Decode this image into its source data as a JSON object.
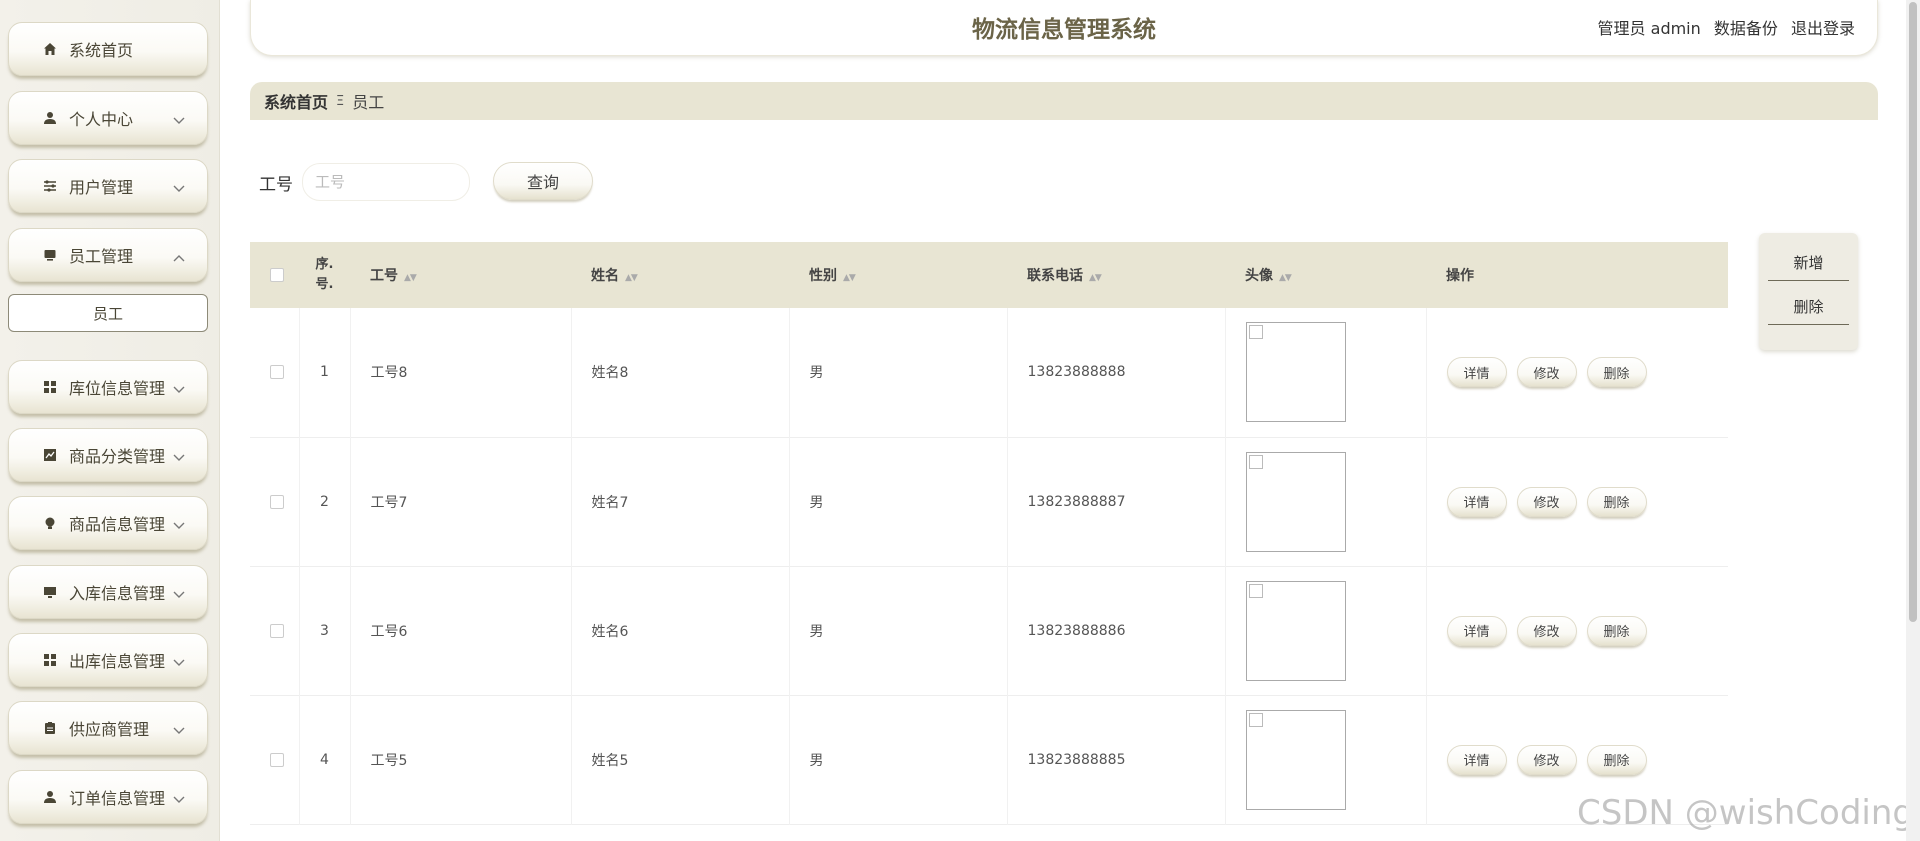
{
  "header": {
    "title": "物流信息管理系统",
    "user_label": "管理员 admin",
    "backup_link": "数据备份",
    "logout_link": "退出登录"
  },
  "sidebar": {
    "items": [
      {
        "label": "系统首页",
        "icon": "home-icon",
        "has_chevron": false
      },
      {
        "label": "个人中心",
        "icon": "person-icon",
        "has_chevron": true
      },
      {
        "label": "用户管理",
        "icon": "sliders-icon",
        "has_chevron": true
      },
      {
        "label": "员工管理",
        "icon": "monitor-icon",
        "has_chevron": true,
        "expanded": true
      },
      {
        "label": "库位信息管理",
        "icon": "grid-icon",
        "has_chevron": true
      },
      {
        "label": "商品分类管理",
        "icon": "chart-icon",
        "has_chevron": true
      },
      {
        "label": "商品信息管理",
        "icon": "bulb-icon",
        "has_chevron": true
      },
      {
        "label": "入库信息管理",
        "icon": "screen-icon",
        "has_chevron": true
      },
      {
        "label": "出库信息管理",
        "icon": "grid-icon",
        "has_chevron": true
      },
      {
        "label": "供应商管理",
        "icon": "clipboard-icon",
        "has_chevron": true
      },
      {
        "label": "订单信息管理",
        "icon": "person-icon",
        "has_chevron": true
      }
    ],
    "sub_item": "员工"
  },
  "breadcrumb": {
    "home": "系统首页",
    "separator": "Ξ",
    "current": "员工"
  },
  "search": {
    "label": "工号",
    "placeholder": "工号",
    "value": "",
    "button": "查询"
  },
  "actions": {
    "add": "新增",
    "delete": "删除"
  },
  "table": {
    "columns": [
      "序号",
      "工号",
      "姓名",
      "性别",
      "联系电话",
      "头像",
      "操作"
    ],
    "index_header_top": "序.",
    "index_header_bottom": "号.",
    "rows": [
      {
        "index": "1",
        "emp_no": "工号8",
        "name": "姓名8",
        "gender": "男",
        "phone": "13823888888"
      },
      {
        "index": "2",
        "emp_no": "工号7",
        "name": "姓名7",
        "gender": "男",
        "phone": "13823888887"
      },
      {
        "index": "3",
        "emp_no": "工号6",
        "name": "姓名6",
        "gender": "男",
        "phone": "13823888886"
      },
      {
        "index": "4",
        "emp_no": "工号5",
        "name": "姓名5",
        "gender": "男",
        "phone": "13823888885"
      }
    ],
    "row_buttons": {
      "detail": "详情",
      "edit": "修改",
      "delete": "删除"
    }
  },
  "watermark": "CSDN @wishCoding",
  "colors": {
    "accent": "#6b6448",
    "table_header_bg": "#e8e5d3",
    "sidebar_bg": "#f3f1ea"
  }
}
